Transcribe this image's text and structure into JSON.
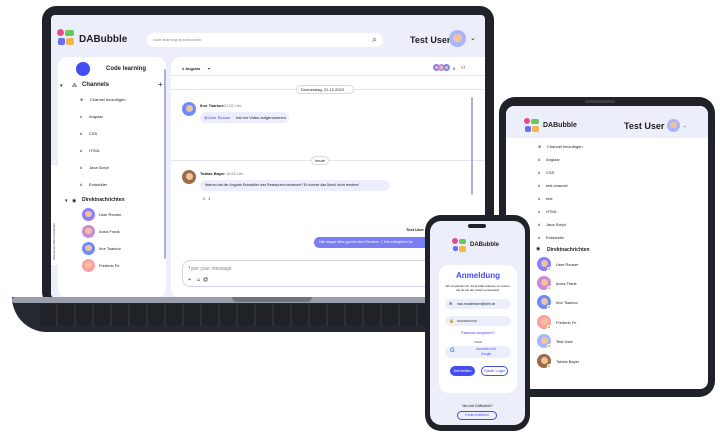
{
  "brand": {
    "name": "DABubble",
    "colors": {
      "primary": "#444df2",
      "bg": "#eceefe",
      "online": "#92c83e"
    }
  },
  "desktop": {
    "search_placeholder": "code learning durchsuchen",
    "user_name": "Test User",
    "workspace": "Code learning",
    "channels_heading": "Channels",
    "add_channel": "Channel hinzufügen",
    "channels": [
      "Angular",
      "CSS",
      "HTML",
      "Java Script",
      "Entwickler"
    ],
    "dm_heading": "Direktnachrichten",
    "contacts": [
      "User Reuser",
      "Anna Frank",
      "Ihor Tsarkov",
      "Frederic Fe"
    ],
    "side_toggle": "Workspace-Menü schließen",
    "channel_name": "# Angular",
    "member_count": "5",
    "date_1": "Donnerstag, 21.12.2023",
    "msg1_name": "Ihor Tsarkov",
    "msg1_time": "21:51 Uhr",
    "msg1_mention": "@User Reuser",
    "msg1_text": " hat ein Video aufgenommen",
    "date_2": "heute",
    "msg2_name": "Tobias Bayer",
    "msg2_time": "15:52 Uhr",
    "msg2_text": "Warum hat der Angular Entwickler das Restaurant verlassen? Er konnte das Menü nicht rendern!",
    "msg2_reaction": "1",
    "msg3_name": "Test User",
    "msg3_time": "16:01 Uhr",
    "msg3_text": "Hier klappt alles gut mit dem Rendern :) Test erfolgreich be",
    "input_placeholder": "Type your message"
  },
  "tablet": {
    "user_name": "Test User",
    "add_channel": "Channel hinzufügen",
    "channels": [
      "Angular",
      "CSS",
      "test channel",
      "test",
      "HTML",
      "Java Script",
      "Entwickler"
    ],
    "dm_heading": "Direktnachrichten",
    "contacts": [
      "User Reuser",
      "Anna Frank",
      "Ihor Tsarkov",
      "Frederic Fe",
      "Test User",
      "Tobias Bayer"
    ]
  },
  "phone": {
    "title": "Anmeldung",
    "description": "Wir empfehlen dir, die E-Mail-Adresse zu nutzen, die du bei der Arbeit verwendest.",
    "email_value": "max.mustermann@web.de",
    "password_value": "••••••••••••••••••",
    "forgot": "Passwort vergessen?",
    "or": "ODER",
    "google": "Anmelden mit Google",
    "login": "Anmelden",
    "guest": "Gäste Login",
    "new_question": "Neu bei DABubble?",
    "create": "Konto erstellen"
  }
}
